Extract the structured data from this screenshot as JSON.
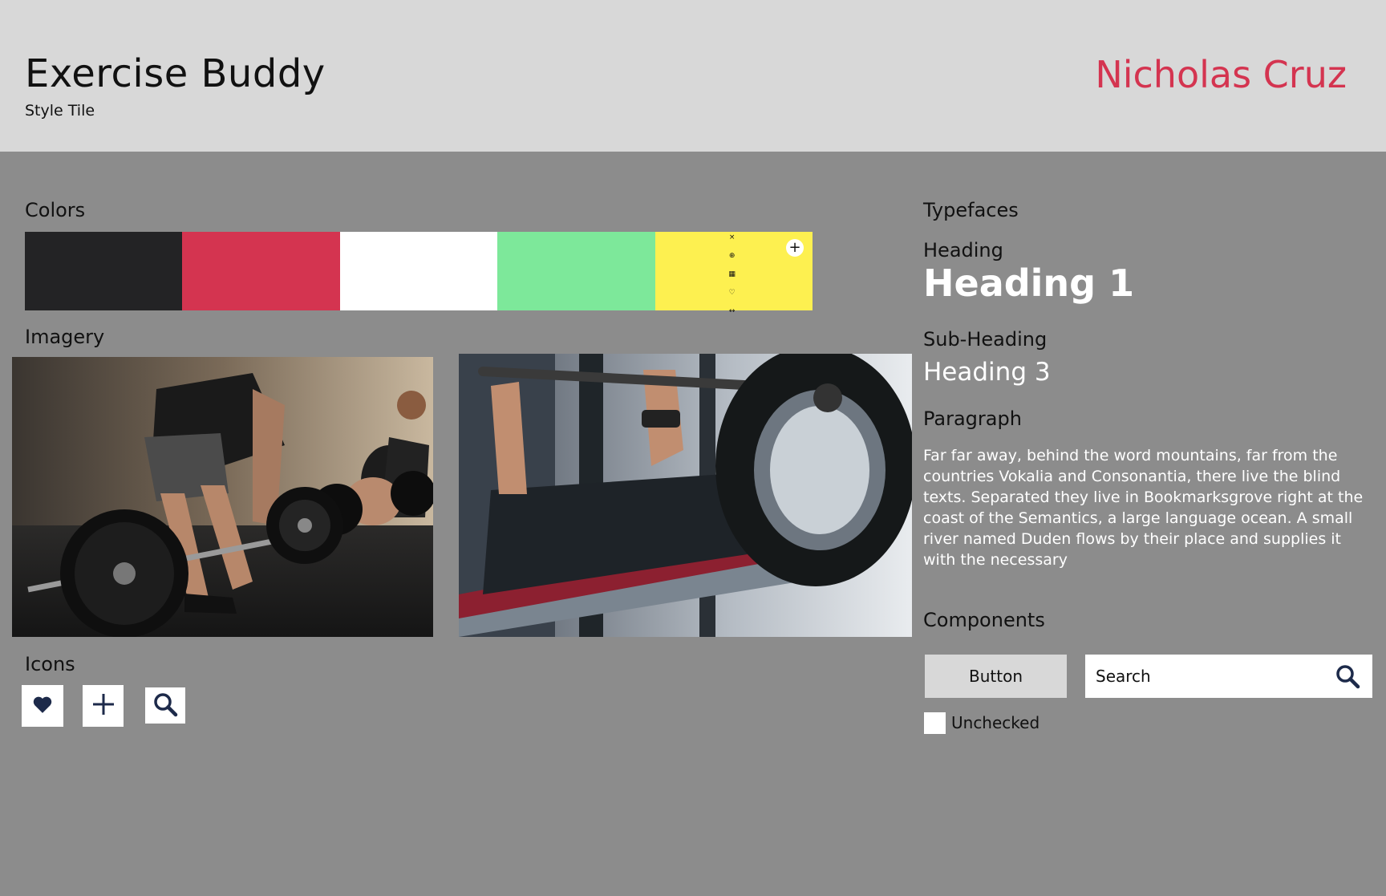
{
  "header": {
    "title": "Exercise Buddy",
    "subtitle": "Style Tile",
    "author": "Nicholas Cruz"
  },
  "colors": {
    "label": "Colors",
    "swatches": [
      "#232325",
      "#d43450",
      "#ffffff",
      "#7de89a",
      "#fdf050"
    ],
    "swatch_tools": [
      "×",
      "⊕",
      "▦",
      "♡",
      "↔"
    ],
    "swatch_add": "+"
  },
  "imagery": {
    "label": "Imagery",
    "photos": [
      "deadlift-photo",
      "bench-press-photo"
    ]
  },
  "icons": {
    "label": "Icons",
    "items": [
      "heart-icon",
      "plus-icon",
      "search-icon"
    ]
  },
  "typefaces": {
    "label": "Typefaces",
    "heading_label": "Heading",
    "heading_sample": "Heading 1",
    "subheading_label": "Sub-Heading",
    "subheading_sample": "Heading 3",
    "paragraph_label": "Paragraph",
    "paragraph_sample": "Far far away, behind the word mountains, far from the countries Vokalia and Consonantia, there live the blind texts. Separated they live in Bookmarksgrove right at the coast of the Semantics, a large language ocean. A small river named Duden flows by their place and supplies it with the necessary"
  },
  "components": {
    "label": "Components",
    "button_label": "Button",
    "search_text": "Search",
    "checkbox_label": "Unchecked"
  },
  "theme": {
    "accent": "#d43450",
    "header_bg": "#d8d8d8",
    "page_bg": "#8c8c8c",
    "icon_color": "#1d2a4a"
  }
}
